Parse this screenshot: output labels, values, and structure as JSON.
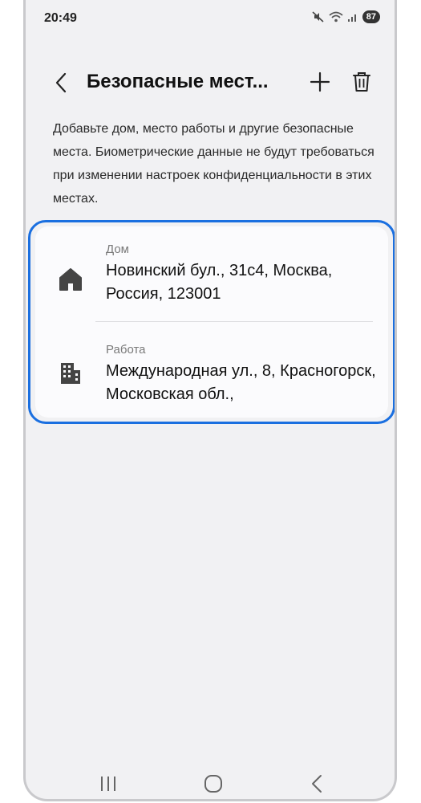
{
  "status_bar": {
    "time": "20:49",
    "battery": "87",
    "icons": [
      "mute-icon",
      "wifi-icon",
      "signal-icon",
      "battery-icon"
    ]
  },
  "header": {
    "title": "Безопасные мест...",
    "back_icon": "chevron-left-icon",
    "add_icon": "plus-icon",
    "delete_icon": "trash-icon"
  },
  "description": "Добавьте дом, место работы и другие безопасные места. Биометрические данные не будут требоваться при изменении настроек конфиденциальности в этих местах.",
  "places": [
    {
      "label": "Дом",
      "address": "Новинский бул., 31с4, Москва, Россия, 123001",
      "icon": "home-icon"
    },
    {
      "label": "Работа",
      "address": "Международная ул., 8, Красногорск, Московская обл.,",
      "icon": "building-icon"
    }
  ],
  "colors": {
    "accent_outline": "#1a6fe0",
    "background": "#f1f1f3",
    "card": "#fbfbfd"
  },
  "navbar": {
    "icons": [
      "recents-icon",
      "home-button-icon",
      "back-nav-icon"
    ]
  }
}
